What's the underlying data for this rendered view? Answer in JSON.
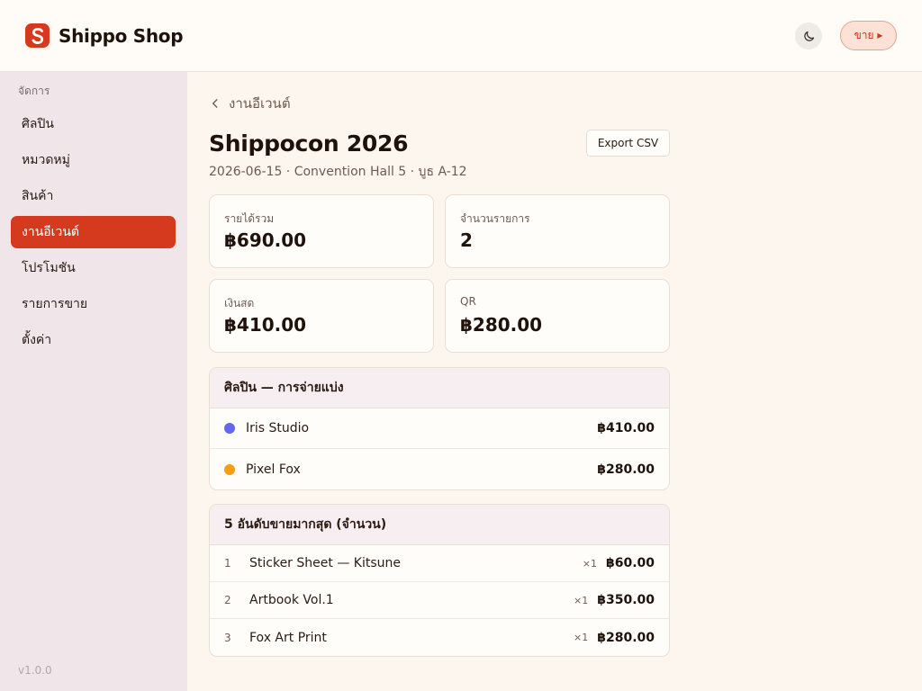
{
  "header": {
    "brand": "Shippo Shop",
    "sell_label": "ขาย ▸"
  },
  "sidebar": {
    "heading": "จัดการ",
    "items": [
      {
        "label": "ศิลปิน"
      },
      {
        "label": "หมวดหมู่"
      },
      {
        "label": "สินค้า"
      },
      {
        "label": "งานอีเวนต์",
        "active": true
      },
      {
        "label": "โปรโมชัน"
      },
      {
        "label": "รายการขาย"
      },
      {
        "label": "ตั้งค่า"
      }
    ],
    "version": "v1.0.0"
  },
  "main": {
    "back_label": "งานอีเวนต์",
    "title": "Shippocon 2026",
    "subtitle": "2026-06-15 · Convention Hall 5 · บูธ A-12",
    "export_label": "Export CSV",
    "stats": [
      {
        "label": "รายได้รวม",
        "value": "฿690.00"
      },
      {
        "label": "จำนวนรายการ",
        "value": "2"
      },
      {
        "label": "เงินสด",
        "value": "฿410.00"
      },
      {
        "label": "QR",
        "value": "฿280.00"
      }
    ],
    "split": {
      "title": "ศิลปิน — การจ่ายแบ่ง",
      "rows": [
        {
          "name": "Iris Studio",
          "amount": "฿410.00",
          "color": "#6366f1"
        },
        {
          "name": "Pixel Fox",
          "amount": "฿280.00",
          "color": "#f59e0b"
        }
      ]
    },
    "top": {
      "title": "5 อันดับขายมากสุด (จำนวน)",
      "rows": [
        {
          "rank": "1",
          "name": "Sticker Sheet — Kitsune",
          "qty": "×1",
          "amount": "฿60.00"
        },
        {
          "rank": "2",
          "name": "Artbook Vol.1",
          "qty": "×1",
          "amount": "฿350.00"
        },
        {
          "rank": "3",
          "name": "Fox Art Print",
          "qty": "×1",
          "amount": "฿280.00"
        }
      ]
    }
  },
  "colors": {
    "accent": "#d63a1e",
    "sidebar_bg": "#f0e6ea",
    "page_bg": "#fdf6ee"
  }
}
